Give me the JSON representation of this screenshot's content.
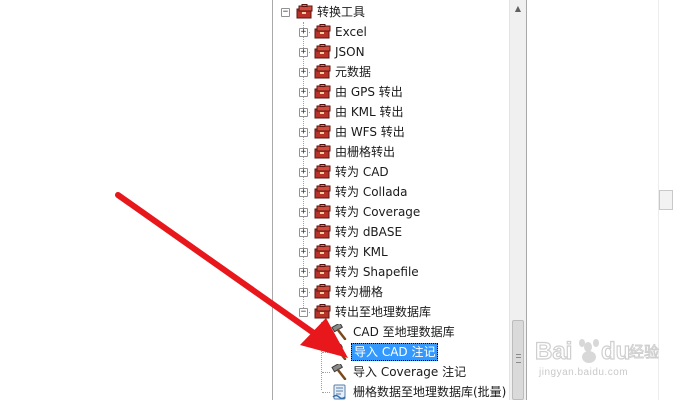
{
  "tree": {
    "root": {
      "label": "转换工具",
      "icon": "toolbox-icon",
      "expanded": true
    },
    "children": [
      {
        "label": "Excel",
        "icon": "toolbox-icon",
        "expanded": false
      },
      {
        "label": "JSON",
        "icon": "toolbox-icon",
        "expanded": false
      },
      {
        "label": "元数据",
        "icon": "toolbox-icon",
        "expanded": false
      },
      {
        "label": "由 GPS 转出",
        "icon": "toolbox-icon",
        "expanded": false
      },
      {
        "label": "由 KML 转出",
        "icon": "toolbox-icon",
        "expanded": false
      },
      {
        "label": "由 WFS 转出",
        "icon": "toolbox-icon",
        "expanded": false
      },
      {
        "label": "由栅格转出",
        "icon": "toolbox-icon",
        "expanded": false
      },
      {
        "label": "转为 CAD",
        "icon": "toolbox-icon",
        "expanded": false
      },
      {
        "label": "转为 Collada",
        "icon": "toolbox-icon",
        "expanded": false
      },
      {
        "label": "转为 Coverage",
        "icon": "toolbox-icon",
        "expanded": false
      },
      {
        "label": "转为 dBASE",
        "icon": "toolbox-icon",
        "expanded": false
      },
      {
        "label": "转为 KML",
        "icon": "toolbox-icon",
        "expanded": false
      },
      {
        "label": "转为 Shapefile",
        "icon": "toolbox-icon",
        "expanded": false
      },
      {
        "label": "转为栅格",
        "icon": "toolbox-icon",
        "expanded": false
      },
      {
        "label": "转出至地理数据库",
        "icon": "toolbox-icon",
        "expanded": true
      }
    ],
    "tools": [
      {
        "label": "CAD 至地理数据库",
        "icon": "hammer-icon",
        "selected": false
      },
      {
        "label": "导入 CAD 注记",
        "icon": "hammer-icon",
        "selected": true
      },
      {
        "label": "导入 Coverage 注记",
        "icon": "hammer-icon",
        "selected": false
      },
      {
        "label": "栅格数据至地理数据库(批量)",
        "icon": "script-icon",
        "selected": false
      }
    ]
  },
  "scrollbar": {
    "up_icon": "▲"
  },
  "watermark": {
    "text": "Bai du 经验",
    "url": "jingyan.baidu.com"
  },
  "colors": {
    "selection": "#3399ff",
    "arrow": "#e8171b",
    "toolbox_red": "#c0392b"
  }
}
